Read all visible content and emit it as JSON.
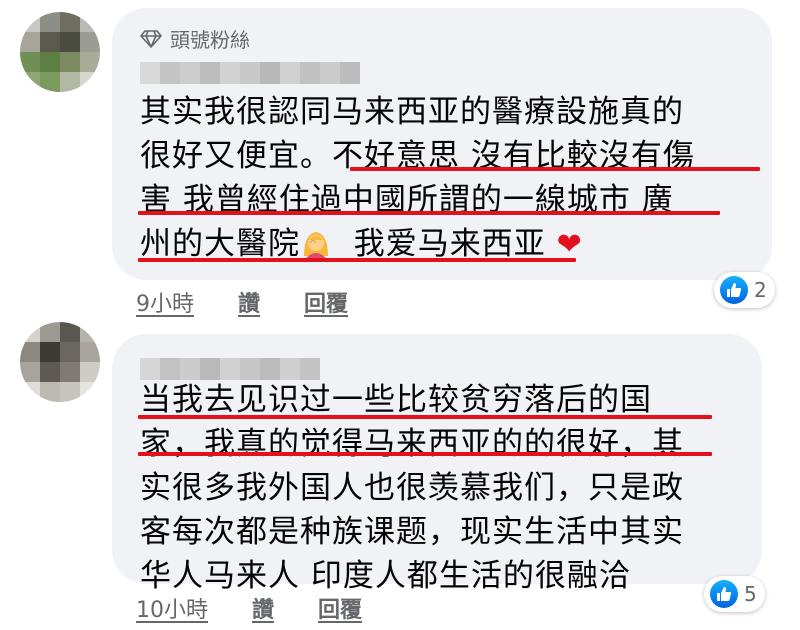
{
  "comments": [
    {
      "badge": "頭號粉絲",
      "lines": [
        "其实我很認同马来西亚的醫療設施真的",
        "很好又便宜。不好意思 沒有比較沒有傷",
        "害 我曾經住過中國所謂的一線城市 廣",
        "州的大醫院",
        "我爱马来西亚"
      ],
      "time": "9小時",
      "like_label": "讚",
      "reply_label": "回覆",
      "reaction_count": "2",
      "emoji": [
        "woman-facepalming-icon",
        "red-heart-icon"
      ]
    },
    {
      "lines": [
        "当我去见识过一些比较贫穷落后的国",
        "家，我真的觉得马来西亚的的很好，其",
        "实很多我外国人也很羡慕我们，只是政",
        "客每次都是种族课题，现实生活中其实",
        "华人马来人 印度人都生活的很融洽"
      ],
      "time": "10小時",
      "like_label": "讚",
      "reply_label": "回覆",
      "reaction_count": "5"
    }
  ],
  "colors": {
    "bubble": "#f0f2f5",
    "underline": "#e3111b",
    "meta_text": "#65676b",
    "like_blue": "#1877f2"
  }
}
